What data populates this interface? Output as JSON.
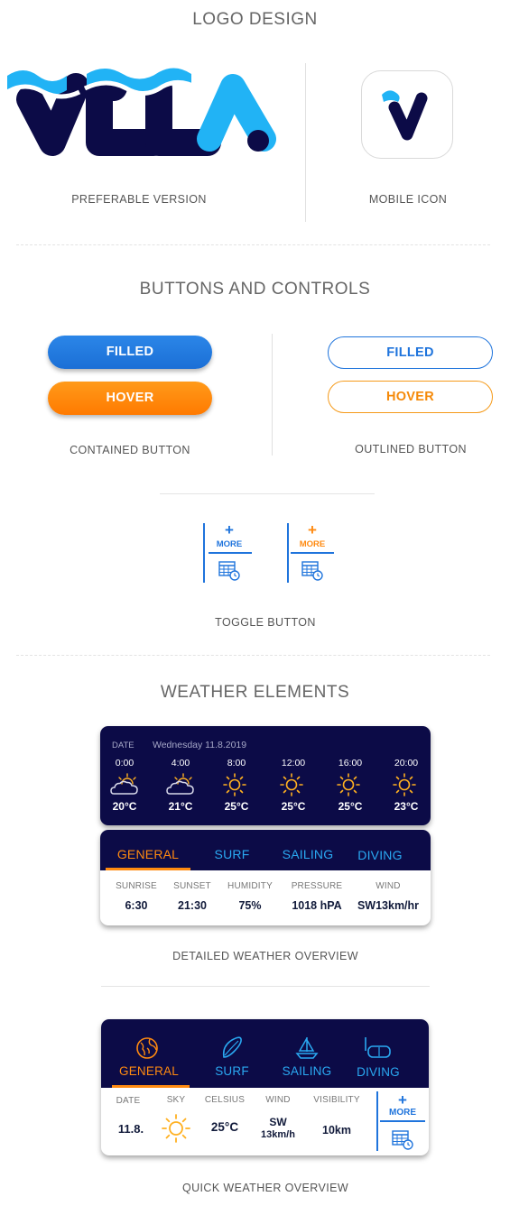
{
  "logo_section": {
    "title": "LOGO DESIGN",
    "brand": "VELA",
    "preferable_caption": "PREFERABLE VERSION",
    "mobile_caption": "MOBILE ICON"
  },
  "buttons_section": {
    "title": "BUTTONS AND CONTROLS",
    "contained": {
      "filled_label": "FILLED",
      "hover_label": "HOVER",
      "caption": "CONTAINED BUTTON"
    },
    "outlined": {
      "filled_label": "FILLED",
      "hover_label": "HOVER",
      "caption": "OUTLINED BUTTON"
    },
    "toggle": {
      "plus": "+",
      "more": "MORE",
      "caption": "TOGGLE BUTTON"
    }
  },
  "weather_section": {
    "title": "WEATHER ELEMENTS",
    "detailed": {
      "date_label": "DATE",
      "date_value": "Wednesday 11.8.2019",
      "hours": [
        {
          "time": "0:00",
          "temp": "20°C",
          "icon": "partly-cloudy-icon"
        },
        {
          "time": "4:00",
          "temp": "21°C",
          "icon": "partly-cloudy-icon"
        },
        {
          "time": "8:00",
          "temp": "25°C",
          "icon": "sun-icon"
        },
        {
          "time": "12:00",
          "temp": "25°C",
          "icon": "sun-icon"
        },
        {
          "time": "16:00",
          "temp": "25°C",
          "icon": "sun-icon"
        },
        {
          "time": "20:00",
          "temp": "23°C",
          "icon": "sun-icon"
        }
      ],
      "tabs": [
        "GENERAL",
        "SURF",
        "SAILING",
        "DIVING"
      ],
      "stats": [
        {
          "label": "SUNRISE",
          "value": "6:30"
        },
        {
          "label": "SUNSET",
          "value": "21:30"
        },
        {
          "label": "HUMIDITY",
          "value": "75%"
        },
        {
          "label": "PRESSURE",
          "value": "1018 hPA"
        },
        {
          "label": "WIND",
          "value": "SW13km/hr"
        }
      ],
      "caption": "DETAILED WEATHER OVERVIEW"
    },
    "quick": {
      "tabs": [
        {
          "label": "GENERAL",
          "icon": "globe-icon"
        },
        {
          "label": "SURF",
          "icon": "surfboard-icon"
        },
        {
          "label": "SAILING",
          "icon": "sailboat-icon"
        },
        {
          "label": "DIVING",
          "icon": "diving-mask-icon"
        }
      ],
      "stats": {
        "date_label": "DATE",
        "date_value": "11.8.",
        "sky_label": "SKY",
        "celsius_label": "CELSIUS",
        "celsius_value": "25°C",
        "wind_label": "WIND",
        "wind_dir": "SW",
        "wind_speed": "13km/h",
        "visibility_label": "VISIBILITY",
        "visibility_value": "10km"
      },
      "more_plus": "+",
      "more_label": "MORE",
      "caption": "QUICK WEATHER OVERVIEW"
    }
  },
  "colors": {
    "navy": "#0c0b47",
    "light_blue": "#21b3f5",
    "accent_blue": "#1f74dc",
    "accent_orange": "#ff8a10"
  }
}
